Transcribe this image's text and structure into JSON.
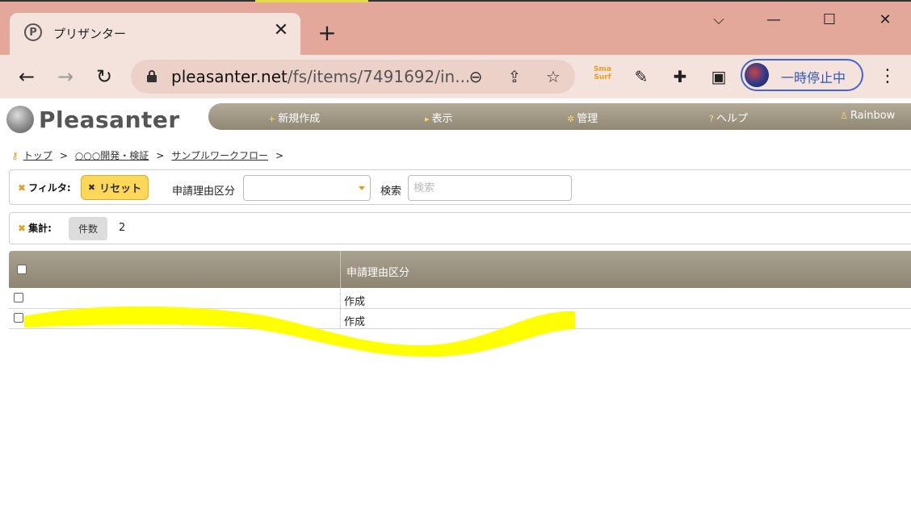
{
  "browser": {
    "tab": {
      "favicon": "P",
      "title": "プリザンター"
    },
    "address": {
      "host": "pleasanter.net",
      "path": "/fs/items/7491692/in..."
    },
    "profile": {
      "label": "一時停止中"
    },
    "extensions": {
      "sma_surf": "Sma Surf"
    }
  },
  "app": {
    "logo_text": "Pleasanter",
    "nav": {
      "new": "新規作成",
      "view": "表示",
      "manage": "管理",
      "help": "ヘルプ",
      "user": "Rainbow"
    },
    "breadcrumb": {
      "items": [
        "トップ",
        "○○○開発・検証",
        "サンプルワークフロー"
      ],
      "separator": ">"
    },
    "filter": {
      "label": "フィルタ:",
      "reset": "リセット",
      "field_label": "申請理由区分",
      "field_value": "",
      "search_label": "検索",
      "search_placeholder": "検索"
    },
    "aggregate": {
      "label": "集計:",
      "type": "件数",
      "count": "2"
    },
    "grid": {
      "columns": [
        "申請理由区分"
      ],
      "rows": [
        {
          "checked": false,
          "reason": "作成"
        },
        {
          "checked": false,
          "reason": "作成"
        }
      ]
    }
  },
  "colors": {
    "tab_strip": "#e3a89a",
    "toolbar": "#f4e2dc",
    "navbar": "#9c937f",
    "accent": "#ffd85a",
    "highlight": "#ffff00"
  }
}
